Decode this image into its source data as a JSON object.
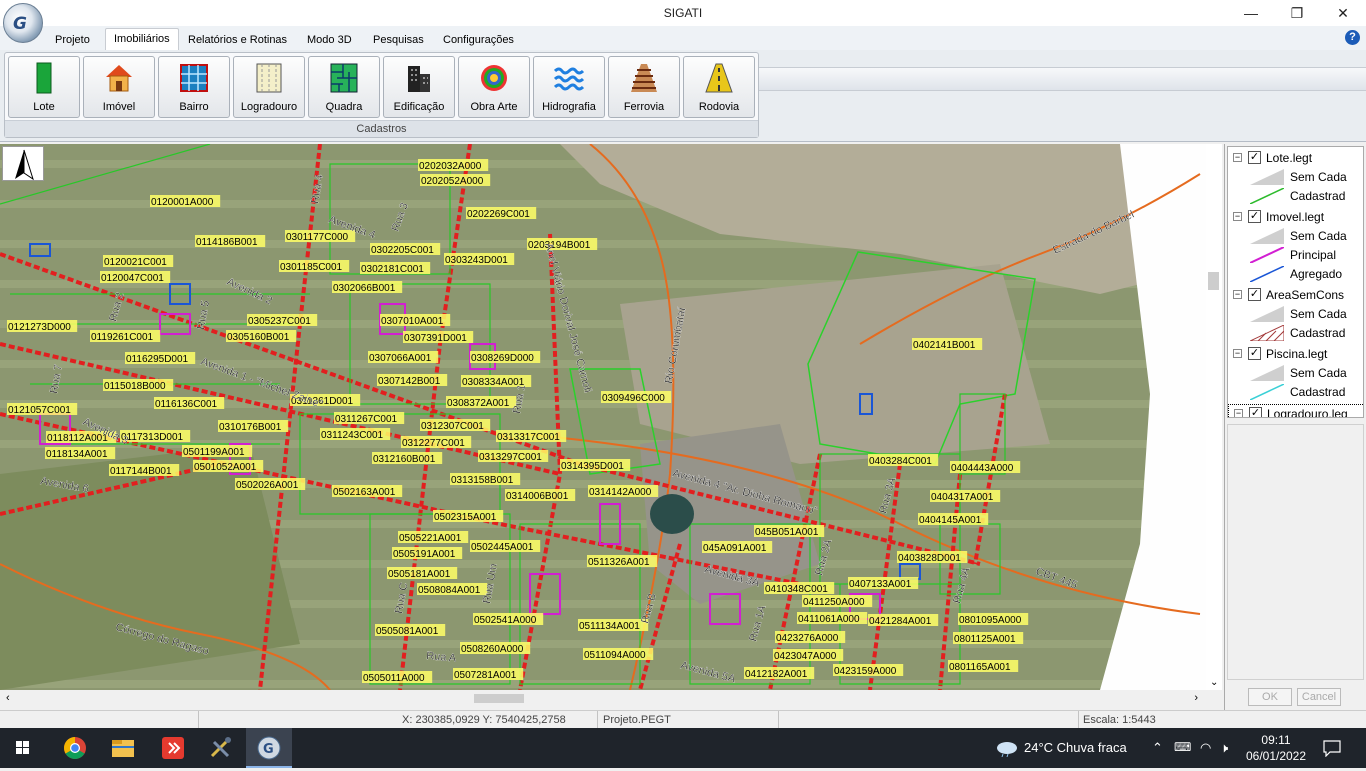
{
  "window": {
    "title": "SIGATI",
    "minimize": "—",
    "maximize": "❐",
    "close": "✕",
    "logo": "G"
  },
  "menu": {
    "items": [
      "Projeto",
      "Imobiliários",
      "Relatórios e Rotinas",
      "Modo 3D",
      "Pesquisas",
      "Configurações"
    ],
    "active": "Imobiliários",
    "help": "?"
  },
  "ribbon": {
    "group_caption": "Cadastros",
    "buttons": [
      {
        "label": "Lote",
        "icon": "lot-icon"
      },
      {
        "label": "Imóvel",
        "icon": "house-icon"
      },
      {
        "label": "Bairro",
        "icon": "neighborhood-grid-icon"
      },
      {
        "label": "Logradouro",
        "icon": "street-icon"
      },
      {
        "label": "Quadra",
        "icon": "block-icon"
      },
      {
        "label": "Edificação",
        "icon": "building-icon"
      },
      {
        "label": "Obra Arte",
        "icon": "bridge-art-icon"
      },
      {
        "label": "Hidrografia",
        "icon": "water-waves-icon"
      },
      {
        "label": "Ferrovia",
        "icon": "railway-icon"
      },
      {
        "label": "Rodovia",
        "icon": "highway-icon"
      }
    ]
  },
  "map": {
    "labels": [
      "0202032A000",
      "0202052A000",
      "0202269C001",
      "0203194B001",
      "0120001A000",
      "0114186B001",
      "0301177C000",
      "0302205C001",
      "0303243D001",
      "0120021C001",
      "0120047C001",
      "0301185C001",
      "0302181C001",
      "0302066B001",
      "0121273D000",
      "0305237C001",
      "0307010A001",
      "0119261C001",
      "0305160B001",
      "0307391D001",
      "0116295D001",
      "0307066A001",
      "0308269D000",
      "0115018B000",
      "0307142B001",
      "0308334A001",
      "0309496C000",
      "0402141B001",
      "0121057C001",
      "0116136C001",
      "0311361D001",
      "0308372A001",
      "0311267C001",
      "0312307C001",
      "0118112A001",
      "0117313D001",
      "0310176B001",
      "0311243C001",
      "0312277C001",
      "0313317C001",
      "0118134A001",
      "0501199A001",
      "0312160B001",
      "0313297C001",
      "0314395D001",
      "0403284C001",
      "0404443A000",
      "0117144B001",
      "0501052A001",
      "0313158B001",
      "0502026A001",
      "0502163A001",
      "0314006B001",
      "0314142A000",
      "0404317A001",
      "0502315A001",
      "0404145A001",
      "0505221A001",
      "045B051A001",
      "0502445A001",
      "045A091A001",
      "0505191A001",
      "0403828D001",
      "0511326A001",
      "0505181A001",
      "0407133A001",
      "0410348C001",
      "0508084A001",
      "0411250A000",
      "0502541A000",
      "0411061A000",
      "0421284A001",
      "0801095A000",
      "0505081A001",
      "0511134A001",
      "0423276A000",
      "0801125A001",
      "0508260A000",
      "0511094A000",
      "0423047A000",
      "0505011A000",
      "0507281A001",
      "0412182A001",
      "0423159A000",
      "0801165A001"
    ],
    "streets": [
      "Rua 4",
      "Avenida 4",
      "Rua 3",
      "Avenida 2",
      "Rua 2",
      "Rua 5",
      "Avenida 1 - \"Michel Zaine\"",
      "Rua 7",
      "Rua 1",
      "Avenida 3",
      "Avenida 6",
      "Anel Viário Dorival José Carnoli",
      "Rio Corumbataí",
      "Estrada do Barbel",
      "Avenida 4 \"Ar. Dinha Romano\"",
      "Avenida 3A",
      "Rua 2A",
      "Rua 3A",
      "Rua 4A",
      "Rua 1A",
      "Rua A",
      "Rua B",
      "Rua C",
      "Rua Um",
      "Avenida 5A",
      "CBT 445",
      "Córrego do Ragaso"
    ]
  },
  "legend": {
    "layers": [
      {
        "name": "Lote.legt",
        "entries": [
          "Sem Cada",
          "Cadastrad"
        ],
        "colors": [
          "#cfcfcf",
          "#2dbb2d"
        ]
      },
      {
        "name": "Imovel.legt",
        "entries": [
          "Sem Cada",
          "Principal",
          "Agregado"
        ],
        "colors": [
          "#cfcfcf",
          "#d21fd2",
          "#1a56d6"
        ]
      },
      {
        "name": "AreaSemCons",
        "entries": [
          "Sem Cada",
          "Cadastrad"
        ],
        "colors": [
          "#cfcfcf",
          "#a33a3a"
        ]
      },
      {
        "name": "Piscina.legt",
        "entries": [
          "Sem Cada",
          "Cadastrad"
        ],
        "colors": [
          "#cfcfcf",
          "#3ad0d6"
        ]
      },
      {
        "name": "Logradouro.leg",
        "entries": [],
        "colors": []
      }
    ],
    "ok": "OK",
    "cancel": "Cancel"
  },
  "status": {
    "coords": "X: 230385,0929 Y: 7540425,2758",
    "project": "Projeto.PEGT",
    "scale": "Escala: 1:5443"
  },
  "taskbar": {
    "weather": "24°C  Chuva fraca",
    "time": "09:11",
    "date": "06/01/2022",
    "apps": [
      "windows-start-icon",
      "chrome-icon",
      "file-explorer-icon",
      "anydesk-icon",
      "tools-icon",
      "sigati-icon"
    ]
  }
}
